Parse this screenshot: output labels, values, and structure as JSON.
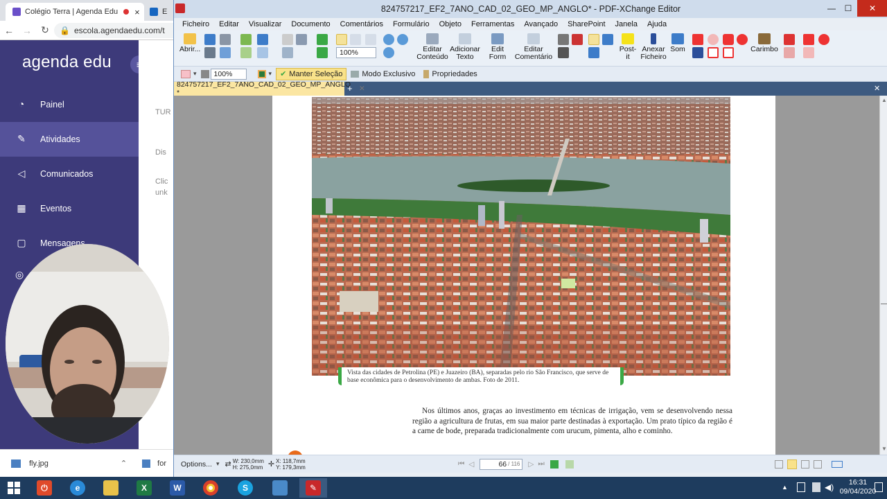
{
  "browser": {
    "tabs": [
      {
        "title": "Colégio Terra | Agenda Edu",
        "close": "×"
      },
      {
        "title": "E"
      }
    ],
    "url": "escola.agendaedu.com/t",
    "logo": "agenda edu",
    "sidebar": [
      {
        "label": "Painel",
        "icon": "speedometer-icon"
      },
      {
        "label": "Atividades",
        "icon": "pencil-icon"
      },
      {
        "label": "Comunicados",
        "icon": "megaphone-icon"
      },
      {
        "label": "Eventos",
        "icon": "calendar-icon"
      },
      {
        "label": "Mensagens",
        "icon": "chat-icon"
      }
    ],
    "main_snippets": [
      "TUR",
      "Dis",
      "Clic",
      "unk"
    ],
    "download": {
      "file": "fly.jpg",
      "second": "for"
    }
  },
  "pdf": {
    "title": "824757217_EF2_7ANO_CAD_02_GEO_MP_ANGLO* - PDF-XChange Editor",
    "menu": [
      "Ficheiro",
      "Editar",
      "Visualizar",
      "Documento",
      "Comentários",
      "Formulário",
      "Objeto",
      "Ferramentas",
      "Avançado",
      "SharePoint",
      "Janela",
      "Ajuda"
    ],
    "ribbon": {
      "open": "Abrir...",
      "zoom": "100%",
      "edit_content": [
        "Editar",
        "Conteúdo"
      ],
      "add_text": [
        "Adicionar",
        "Texto"
      ],
      "edit_form": [
        "Edit",
        "Form"
      ],
      "edit_comment": [
        "Editar",
        "Comentário"
      ],
      "postit": [
        "Post-",
        "it"
      ],
      "attach": [
        "Anexar",
        "Ficheiro"
      ],
      "sound": "Som",
      "stamp": "Carimbo"
    },
    "toolbar2": {
      "zoom": "100%",
      "keep_selection": "Manter Seleção",
      "exclusive": "Modo Exclusivo",
      "properties": "Propriedades"
    },
    "doc_tab": "824757217_EF2_7ANO_CAD_02_GEO_MP_ANGLO *",
    "caption": "Vista das cidades de Petrolina (PE) e Juazeiro (BA), separadas pelo rio São Francisco, que serve de base econômica para o desenvolvimento de ambas. Foto de 2011.",
    "paragraph": "Nos últimos anos, graças ao investimento em técnicas de irrigação, vem se desenvolvendo nessa região a agricultura de frutas, em sua maior parte destinadas à exportação. Um prato típico da região é a carne de bode, preparada tradicionalmente com urucum, pimenta, alho e cominho.",
    "status": {
      "options": "Options...",
      "size_w": "W: 230,0mm",
      "size_h": "H: 275,0mm",
      "pos_x": "X: 118,7mm",
      "pos_y": "Y: 179,3mm",
      "page": "66",
      "pages": "/ 116"
    }
  },
  "taskbar": {
    "time": "16:31",
    "date": "09/04/2020"
  },
  "colors": {
    "sidebar": "#3d3a7a",
    "accent_green": "#3aa845",
    "pdf_red": "#c8282a"
  }
}
